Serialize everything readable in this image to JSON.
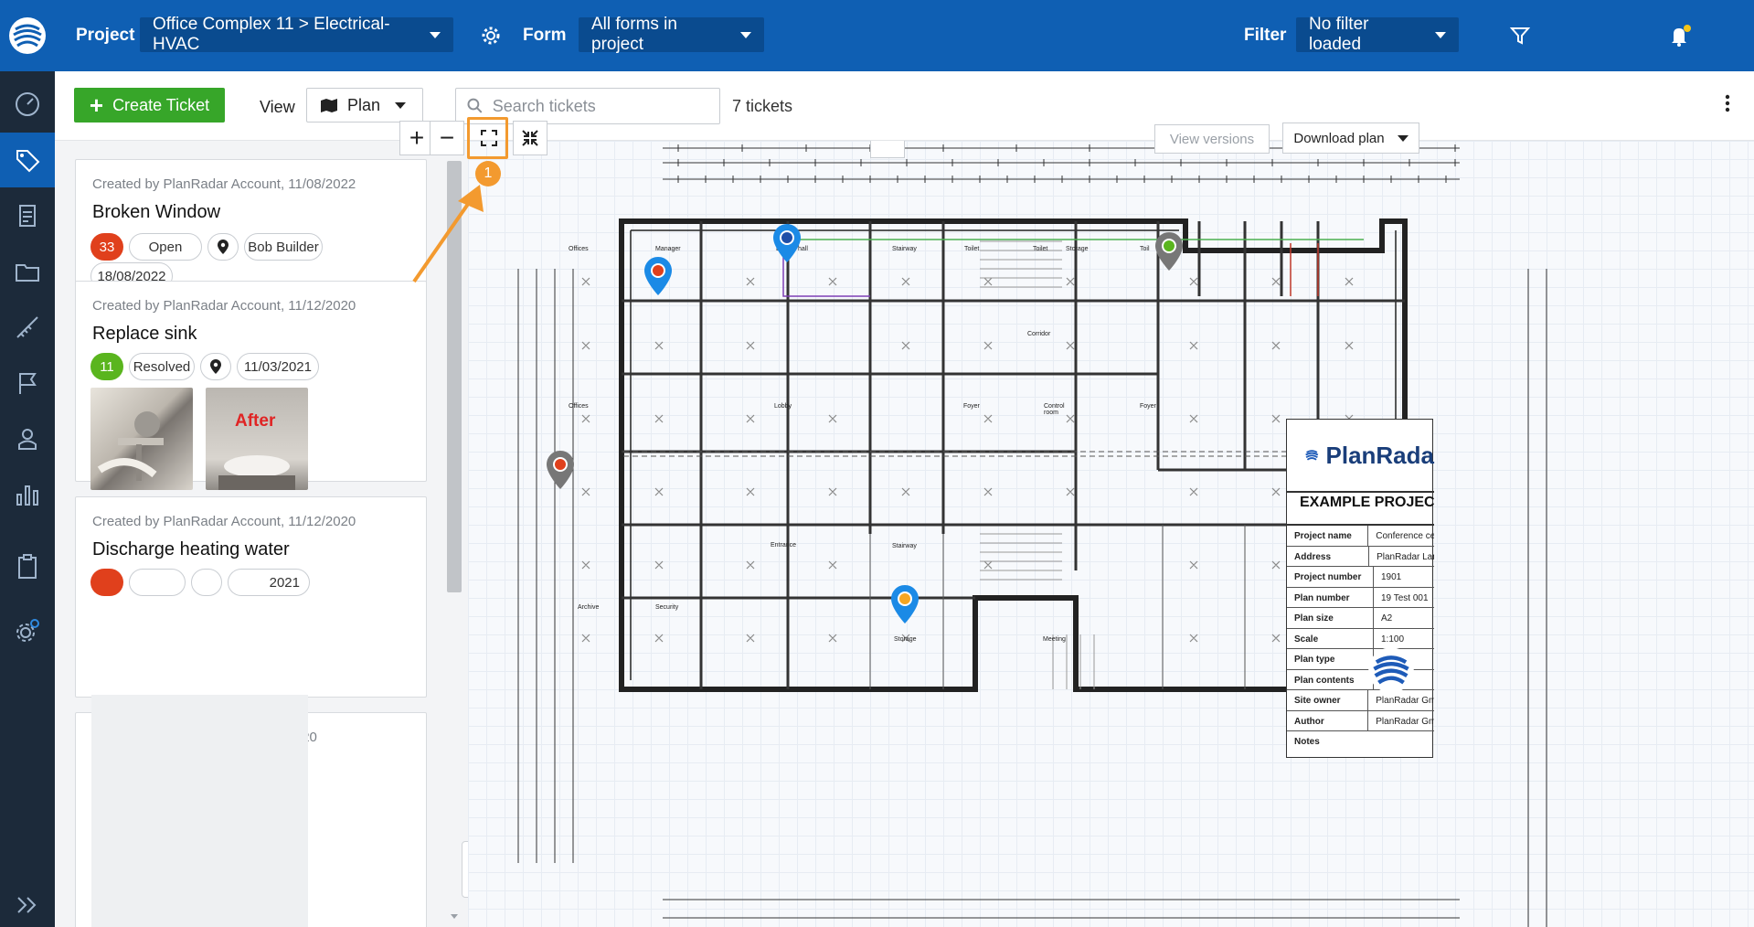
{
  "header": {
    "project_label": "Project",
    "project_value": "Office Complex 11 > Electrical-HVAC",
    "form_label": "Form",
    "form_value": "All forms in project",
    "filter_label": "Filter",
    "filter_value": "No filter loaded",
    "accent_color": "#0f5fb3"
  },
  "toolbar": {
    "create_label": "Create Ticket",
    "view_label": "View",
    "view_value": "Plan",
    "search_placeholder": "Search tickets",
    "ticket_count": "7 tickets"
  },
  "tickets": [
    {
      "meta": "Created by PlanRadar Account, 11/08/2022",
      "title": "Broken Window",
      "number": "33",
      "status": "Open",
      "assignee": "Bob Builder",
      "date": "18/08/2022",
      "number_color": "#e0401c"
    },
    {
      "meta": "Created by PlanRadar Account, 11/12/2020",
      "title": "Replace sink",
      "number": "11",
      "status": "Resolved",
      "date": "11/03/2021",
      "number_color": "#5ab51e",
      "after_label": "After"
    },
    {
      "meta": "Created by PlanRadar Account, 11/12/2020",
      "title": "Discharge heating water",
      "date_partial": "2021"
    },
    {
      "meta_partial": "2/2020"
    }
  ],
  "plan": {
    "view_versions_label": "View versions",
    "download_label": "Download plan",
    "step_badge": "1",
    "rooms": [
      "Offices",
      "Manager",
      "D",
      "hall",
      "Stairway",
      "Toilet",
      "Toilet",
      "Storage",
      "Toil",
      "Corridor",
      "Offices",
      "Lobby",
      "Foyer",
      "Control room",
      "Foyer",
      "Entrance",
      "Stairway",
      "Archive",
      "Security",
      "Storage",
      "Meeting"
    ],
    "title_block": {
      "brand": "PlanRada",
      "project_heading": "EXAMPLE PROJEC",
      "rows": [
        {
          "k": "Project name",
          "v": "Conference cer"
        },
        {
          "k": "Address",
          "v": "PlanRadar Lan"
        },
        {
          "k": "Project number",
          "v": "1901"
        },
        {
          "k": "Plan number",
          "v": "19 Test 001"
        },
        {
          "k": "Plan size",
          "v": "A2"
        },
        {
          "k": "Scale",
          "v": "1:100"
        },
        {
          "k": "Plan type",
          "v": ""
        },
        {
          "k": "Plan contents",
          "v": "ior"
        },
        {
          "k": "Site owner",
          "v": "PlanRadar Gml"
        },
        {
          "k": "Author",
          "v": "PlanRadar Gml"
        },
        {
          "k": "Notes",
          "v": ""
        }
      ]
    }
  }
}
